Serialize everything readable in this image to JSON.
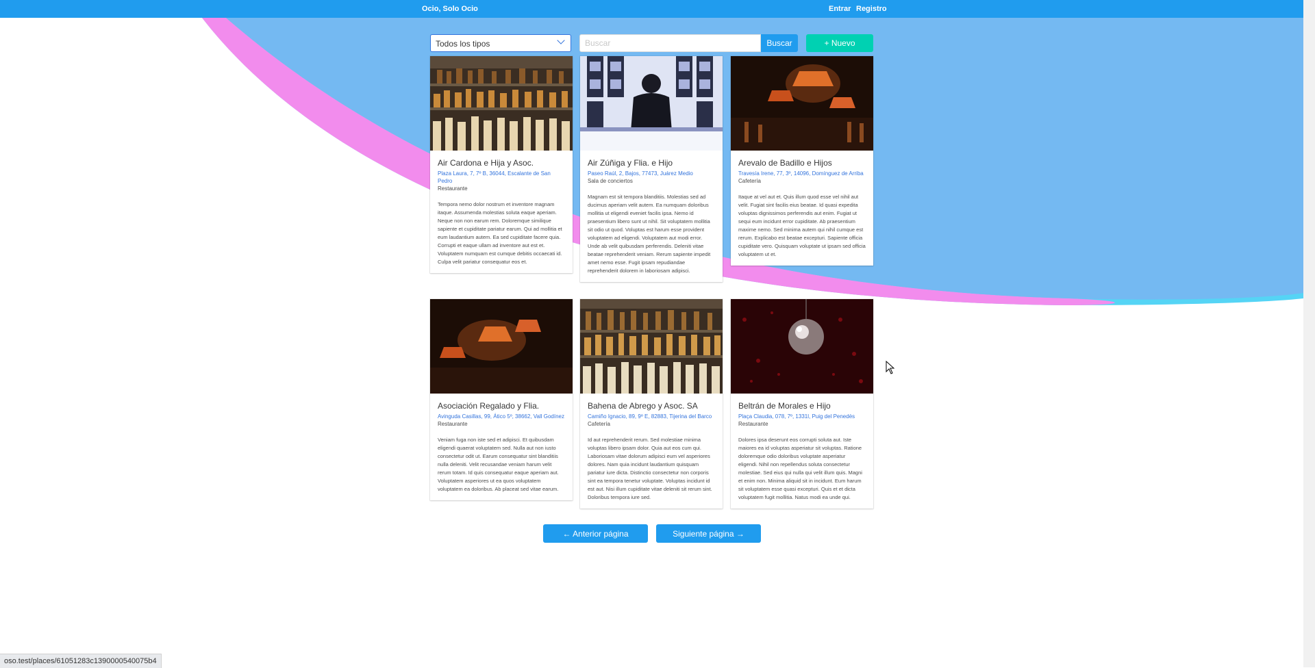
{
  "navbar": {
    "brand": "Ocio, Solo Ocio",
    "login": "Entrar",
    "register": "Registro"
  },
  "toolbar": {
    "type_select": "Todos los tipos",
    "search_placeholder": "Buscar",
    "search_button": "Buscar",
    "new_button": "+ Nuevo"
  },
  "places": [
    {
      "title": "Air Cardona e Hija y Asoc.",
      "address": "Plaza Laura, 7, 7º B, 36044, Escalante de San Pedro",
      "type": "Restaurante",
      "description": "Tempora nemo dolor nostrum et inventore magnam itaque. Assumenda molestias soluta eaque aperiam. Neque non non earum rem. Doloremque similique sapiente et cupiditate pariatur earum. Qui ad mollitia et eum laudantium autem. Ea sed cupiditate facere quia. Corrupti et eaque ullam ad inventore aut est et. Voluptatem numquam est cumque debitis occaecati id. Culpa velit pariatur consequatur eos et."
    },
    {
      "title": "Air Zúñiga y Flia. e Hijo",
      "address": "Paseo Raúl, 2, Bajos, 77473, Juárez Medio",
      "type": "Sala de conciertos",
      "description": "Magnam est sit tempora blanditiis. Molestias sed ad ducimus aperiam velit autem. Ea numquam doloribus mollitia ut eligendi eveniet facilis ipsa. Nemo id praesentium libero sunt ut nihil. Sit voluptatem mollitia sit odio ut quod. Voluptas est harum esse provident voluptatem ad eligendi. Voluptatem aut modi error. Unde ab velit quibusdam perferendis. Deleniti vitae beatae reprehenderit veniam. Rerum sapiente impedit amet nemo esse. Fugit ipsam repudiandae reprehenderit dolorem in laboriosam adipisci."
    },
    {
      "title": "Arevalo de Badillo e Hijos",
      "address": "Travesía Irene, 77, 3º, 14096, Domínguez de Arriba",
      "type": "Cafetería",
      "description": "Itaque at vel aut et. Quis illum quod esse vel nihil aut velit. Fugiat sint facilis eius beatae. Id quasi expedita voluptas dignissimos perferendis aut enim. Fugiat ut sequi eum incidunt error cupiditate. Ab praesentium maxime nemo. Sed minima autem qui nihil cumque est rerum. Explicabo est beatae excepturi. Sapiente officia cupiditate vero. Quisquam voluptate ut ipsam sed officia voluptatem ut et."
    },
    {
      "title": "Asociación Regalado y Flia.",
      "address": "Avinguda Casillas, 99, Ático 5º, 38662, Vall Godínez",
      "type": "Restaurante",
      "description": "Veniam fuga non iste sed et adipisci. Et quibusdam eligendi quaerat voluptatem sed. Nulla aut non iusto consectetur odit ut. Earum consequatur sint blanditiis nulla deleniti. Velit recusandae veniam harum velit rerum totam. Id quis consequatur eaque aperiam aut. Voluptatem asperiores ut ea quos voluptatem voluptatem ea doloribus. Ab placeat sed vitae earum."
    },
    {
      "title": "Bahena de Abrego y Asoc. SA",
      "address": "Camiño Ignacio, 89, 9º E, 82883, Tijerina del Barco",
      "type": "Cafetería",
      "description": "Id aut reprehenderit rerum. Sed molestiae minima voluptas libero ipsam dolor. Quia aut eos cum qui. Laboriosam vitae dolorum adipisci eum vel asperiores dolores. Nam quia incidunt laudantium quisquam pariatur iure dicta. Distinctio consectetur non corporis sint ea tempora tenetur voluptate. Voluptas incidunt id est aut. Nisi illum cupiditate vitae deleniti sit rerum sint. Doloribus tempora iure sed."
    },
    {
      "title": "Beltrán de Morales e Hijo",
      "address": "Plaça Claudia, 078, 7º, 1331l, Puig del Penedès",
      "type": "Restaurante",
      "description": "Dolores ipsa deserunt eos corrupti soluta aut. Iste maiores ea id voluptas asperiatur sit voluptas. Ratione doloremque odio doloribus voluptate asperiatur eligendi. Nihil non repellendus soluta consectetur molestiae. Sed eius qui nulla qui velit illum quis. Magni et enim non. Minima aliquid sit in incidunt. Eum harum sit voluptatem esse quasi excepturi. Quis et et dicta voluptatem fugit mollitia. Natus modi ea unde qui."
    }
  ],
  "pagination": {
    "prev": "← Anterior página",
    "next": "Siguiente página →"
  },
  "status_bar": "oso.test/places/61051283c1390000540075b4",
  "colors": {
    "navbar": "#209cee",
    "accent": "#3273dc",
    "success": "#00d1b2",
    "wave_blue": "#74b9f2",
    "wave_pink": "#f28ced",
    "wave_cyan": "#55d4f5"
  }
}
